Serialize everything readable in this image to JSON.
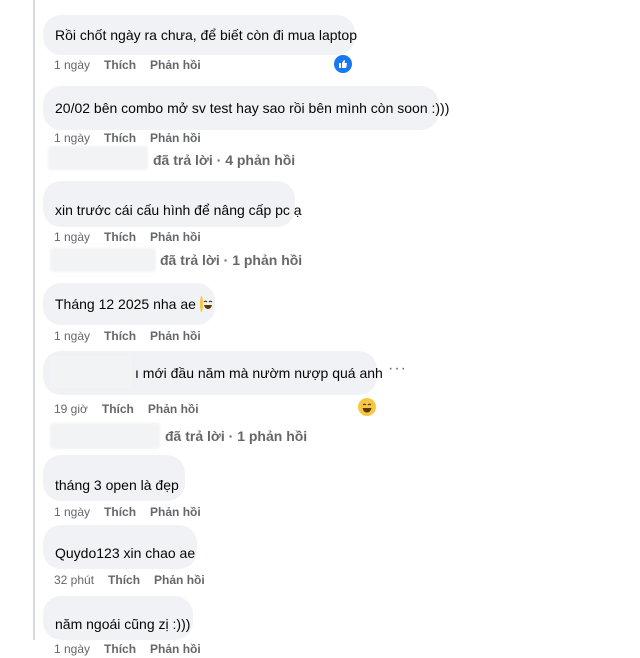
{
  "colors": {
    "bubble": "#f0f2f5",
    "meta_text": "#65676b",
    "like_blue": "#1877f2"
  },
  "comments": [
    {
      "text": "Rồi chốt ngày ra chưa, để biết còn đi mua laptop",
      "time": "1 ngày",
      "like": "Thích",
      "reply": "Phản hồi",
      "reaction": "like-icon"
    },
    {
      "text": "20/02 bên combo mở sv test hay sao rồi bên mình còn soon :)))",
      "time": "1 ngày",
      "like": "Thích",
      "reply": "Phản hồi",
      "replies": "đã trả lời · 4 phản hồi"
    },
    {
      "text": "xin trước cái cấu hình để nâng cấp pc ạ",
      "time": "1 ngày",
      "like": "Thích",
      "reply": "Phản hồi",
      "replies": "đã trả lời · 1 phản hồi"
    },
    {
      "text": "Tháng 12 2025 nha ae",
      "time": "1 ngày",
      "like": "Thích",
      "reply": "Phản hồi",
      "emoji": "laughing-emoji"
    },
    {
      "text": "ı mới đầu năm mà nườm nượp quá anh",
      "time": "19 giờ",
      "like": "Thích",
      "reply": "Phản hồi",
      "more": "···",
      "reaction": "haha-icon",
      "replies": "đã trả lời · 1 phản hồi"
    },
    {
      "text": "tháng 3 open là đẹp",
      "time": "1 ngày",
      "like": "Thích",
      "reply": "Phản hồi"
    },
    {
      "text": "Quydo123 xin chao ae",
      "time": "32 phút",
      "like": "Thích",
      "reply": "Phản hồi"
    },
    {
      "text": "năm ngoái cũng zị :)))",
      "time": "1 ngày",
      "like": "Thích",
      "reply": "Phản hồi"
    }
  ]
}
